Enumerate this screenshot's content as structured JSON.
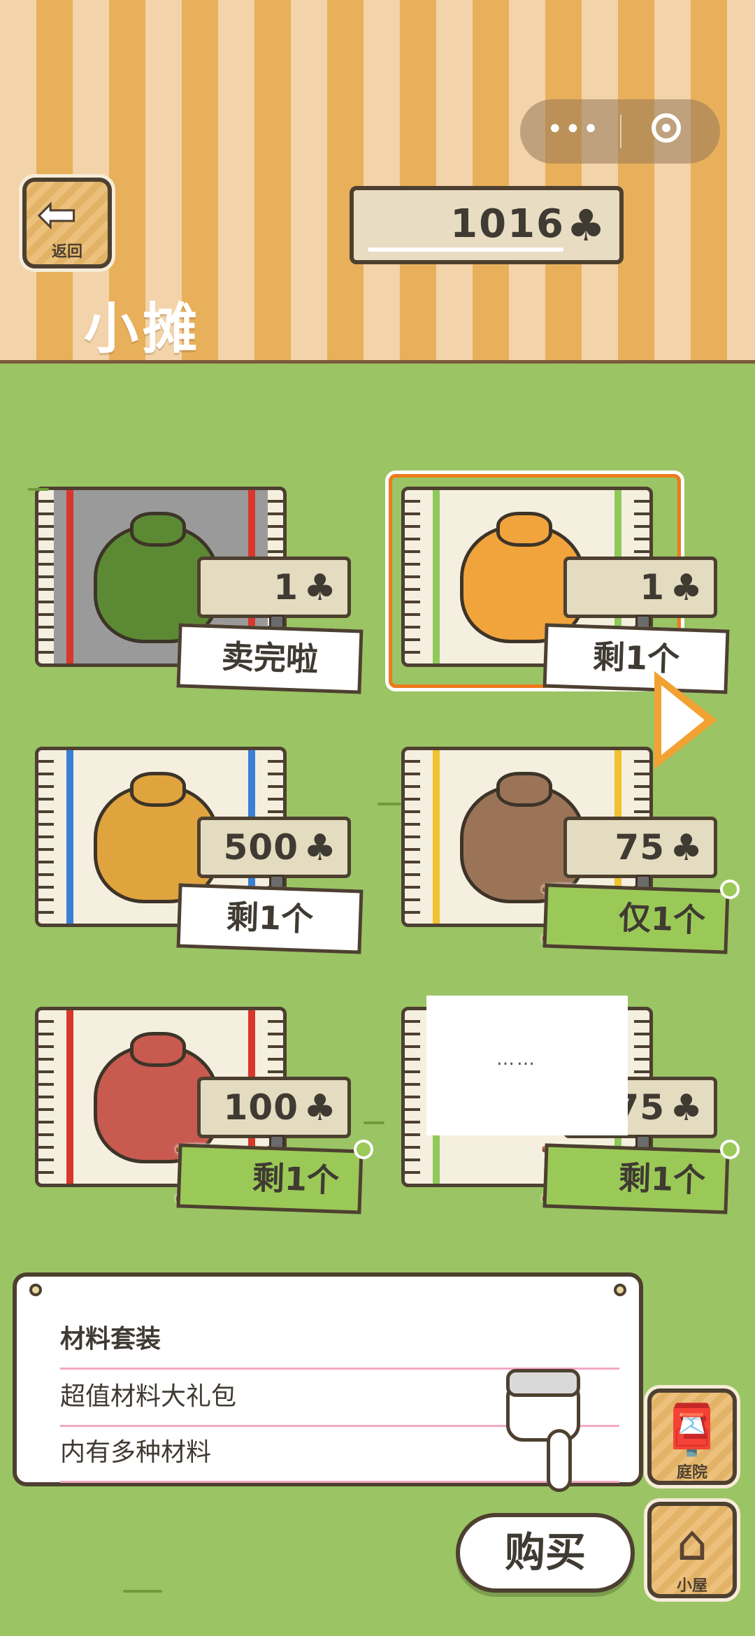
{
  "header": {
    "back_label": "返回",
    "back_icon": "arrow-left-icon",
    "currency": {
      "value": "1016",
      "icon": "clover-icon"
    },
    "title": "小摊",
    "capsule": {
      "more_icon": "more-dots-icon",
      "close_icon": "target-icon"
    }
  },
  "items": [
    {
      "name": "green-bag",
      "price": "1",
      "status": "卖完啦",
      "limited": false,
      "selected": false,
      "stripe": "#d9372a",
      "mat_bg": "#9a9a9a"
    },
    {
      "name": "orange-bag",
      "price": "1",
      "status": "剩1个",
      "limited": false,
      "selected": true,
      "stripe": "#8fc95a",
      "mat_bg": "#f5efdf"
    },
    {
      "name": "table-card",
      "price": "500",
      "status": "剩1个",
      "limited": false,
      "selected": false,
      "stripe": "#3b7fd6",
      "mat_bg": "#f5efdf"
    },
    {
      "name": "seed-bag",
      "price": "75",
      "status": "仅1个",
      "limited": true,
      "selected": false,
      "stripe": "#f2c030",
      "mat_bg": "#f5efdf"
    },
    {
      "name": "red-paper",
      "price": "100",
      "status": "剩1个",
      "limited": true,
      "selected": false,
      "stripe": "#d9372a",
      "mat_bg": "#f5efdf"
    },
    {
      "name": "loading-item",
      "price": "375",
      "status": "剩1个",
      "limited": true,
      "selected": false,
      "stripe": "#8fc95a",
      "mat_bg": "#f5efdf"
    }
  ],
  "loading_text": "……",
  "description": {
    "title": "材料套装",
    "line1": "超值材料大礼包",
    "line2": "内有多种材料"
  },
  "buttons": {
    "yard_label": "庭院",
    "home_label": "小屋",
    "buy_label": "购买"
  },
  "colors": {
    "grass": "#9bc464",
    "awning_light": "#f3d3a9",
    "awning_dark": "#e8b05a",
    "outline": "#4d4030",
    "selected_border": "#ef7a1a"
  }
}
